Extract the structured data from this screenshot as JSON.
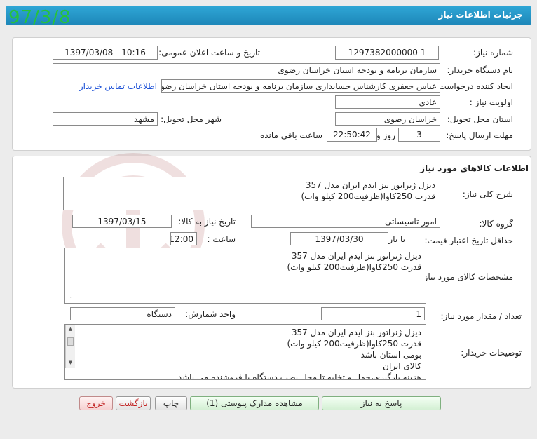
{
  "header": {
    "title": "جزئیات اطلاعات نیاز"
  },
  "date_stamp": "97/3/8",
  "info": {
    "need_number_label": "شماره نیاز:",
    "need_number": "1297382000000 1",
    "announce_label": "تاریخ و ساعت اعلان عمومی:",
    "announce_value": "1397/03/08 - 10:16",
    "buyer_org_label": "نام دستگاه خریدار:",
    "buyer_org": "سازمان برنامه و بودجه استان خراسان رضوی",
    "creator_label": "ایجاد کننده درخواست:",
    "creator": "عباس جعفری کارشناس حسابداری سازمان برنامه و بودجه استان خراسان رضوی",
    "contact_link": "اطلاعات تماس خریدار",
    "priority_label": "اولویت نیاز :",
    "priority": "عادی",
    "province_label": "استان محل تحویل:",
    "province": "خراسان رضوی",
    "city_label": "شهر محل تحویل:",
    "city": "مشهد",
    "deadline_label": "مهلت ارسال پاسخ:",
    "deadline_days": "3",
    "days_word": "روز و",
    "deadline_time": "22:50:42",
    "remaining_text": "ساعت باقی مانده"
  },
  "goods": {
    "section_title": "اطلاعات کالاهای مورد نیاز",
    "general_desc_label": "شرح کلی نیاز:",
    "general_desc": [
      "دیزل ژنراتور بنز ایدم ایران مدل 357",
      "قدرت 250کاوا(ظرفیت200 کیلو وات)"
    ],
    "group_label": "گروه کالا:",
    "group": "امور تاسیساتی",
    "need_date_label": "تاریخ نیاز به کالا:",
    "need_date": "1397/03/15",
    "min_validity_label": "حداقل تاریخ اعتبار قیمت:",
    "until_date_label": "تا تاریخ :",
    "until_date": "1397/03/30",
    "time_label": "ساعت :",
    "time": "12:00",
    "spec_label": "مشخصات کالای مورد نیاز:",
    "spec": [
      "دیزل ژنراتور بنز ایدم ایران مدل 357",
      "قدرت 250کاوا(ظرفیت200 کیلو وات)"
    ],
    "qty_label": "تعداد / مقدار مورد نیاز:",
    "qty": "1",
    "unit_label": "واحد شمارش:",
    "unit": "دستگاه",
    "buyer_notes_label": "توضیحات خریدار:",
    "buyer_notes": [
      "دیزل ژنراتور بنز ایدم ایران مدل 357",
      "قدرت 250کاوا(ظرفیت200 کیلو وات)",
      "بومی استان باشد",
      "کالای ایران",
      "هزینه بارگیری،حمل و تخلیه تا محل نصب دستگاه با فروشنده می باشد"
    ]
  },
  "buttons": {
    "reply": "پاسخ به نیاز",
    "view_docs": "مشاهده مدارک پیوستی (1)",
    "print": "چاپ",
    "back": "بازگشت",
    "exit": "خروج"
  }
}
